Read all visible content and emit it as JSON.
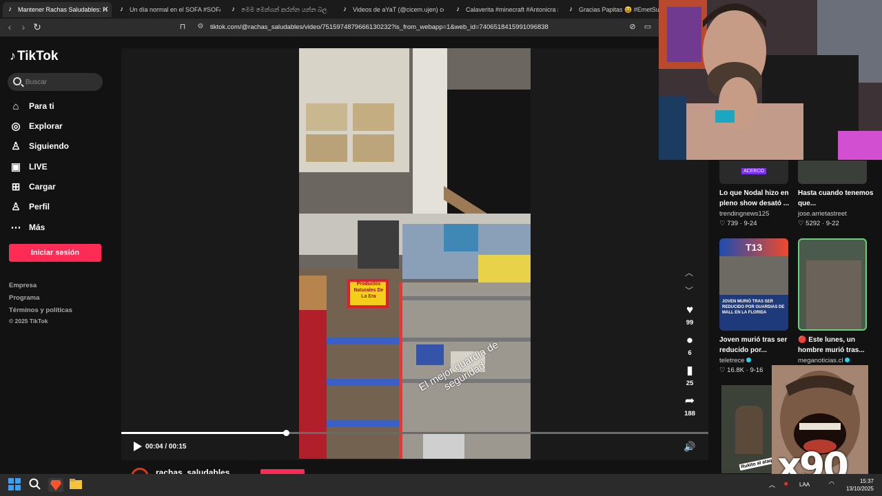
{
  "browser": {
    "tabs": [
      {
        "label": "Mantener Rachas Saludables: H",
        "active": true
      },
      {
        "label": "Un día normal en el SOFA #SOFA #fy",
        "active": false
      },
      {
        "label": "මෙම මෙන්ශන් කරන්න යන්න බල",
        "active": false
      },
      {
        "label": "Videos de aYaT (@cicem.ujen) con",
        "active": false
      },
      {
        "label": "Calaverita #minecraft #Antonicra #c",
        "active": false
      },
      {
        "label": "Gracias Papitas 😆 #EmetSuki #a",
        "active": false
      }
    ],
    "tab_close": "✕",
    "url": "tiktok.com/@rachas_saludables/video/7515974879666130232?is_from_webapp=1&web_id=7406518415991096838"
  },
  "sidebar": {
    "logo": "TikTok",
    "search_placeholder": "Buscar",
    "nav": [
      {
        "label": "Para ti",
        "icon": "home-icon"
      },
      {
        "label": "Explorar",
        "icon": "compass-icon"
      },
      {
        "label": "Siguiendo",
        "icon": "following-icon"
      },
      {
        "label": "LIVE",
        "icon": "live-icon"
      },
      {
        "label": "Cargar",
        "icon": "upload-icon"
      },
      {
        "label": "Perfil",
        "icon": "profile-icon"
      },
      {
        "label": "Más",
        "icon": "more-icon"
      }
    ],
    "login_label": "Iniciar sesión",
    "footer_links": [
      "Empresa",
      "Programa",
      "Términos y políticas"
    ],
    "copyright": "© 2025 TikTok"
  },
  "video": {
    "caption": "El mejor guardia de seguridad",
    "sign_text": "Productos Naturales De La Era",
    "timecode": "00:04 / 00:15",
    "progress": 0.28,
    "author": "rachas_saludables"
  },
  "actions": [
    {
      "icon": "heart-icon",
      "count": "99"
    },
    {
      "icon": "comment-icon",
      "count": "6"
    },
    {
      "icon": "bookmark-icon",
      "count": "25"
    },
    {
      "icon": "share-icon",
      "count": "188"
    }
  ],
  "recommendations": [
    {
      "title": "Lo que Nodal hizo en pleno show desató ...",
      "author": "trendingnews125",
      "likes": "739",
      "date": "9-24",
      "badge": "ACERCO",
      "verified": false
    },
    {
      "title": "Hasta cuando tenemos que...",
      "author": "jose.arrietastreet",
      "likes": "5292",
      "date": "9-22",
      "verified": false
    },
    {
      "title": "Joven murió tras ser reducido por...",
      "author": "teletrece",
      "likes": "16.8K",
      "date": "9-16",
      "thumb_brand": "T13",
      "thumb_headline": "JOVEN MURIÓ TRAS SER REDUCIDO POR GUARDIAS DE MALL EN LA FLORIDA",
      "verified": true
    },
    {
      "title": "🔴 Este lunes, un hombre murió tras...",
      "author": "meganoticias.cl",
      "verified": true
    },
    {
      "thumb_caption": "Rukito al ataq"
    }
  ],
  "overlay": {
    "multiplier": "x90"
  },
  "taskbar": {
    "lang": "LAA",
    "time": "15:37",
    "date": "13/10/2025"
  },
  "colors": {
    "accent": "#fe2c55",
    "background": "#121212",
    "verified": "#20d5ec"
  }
}
